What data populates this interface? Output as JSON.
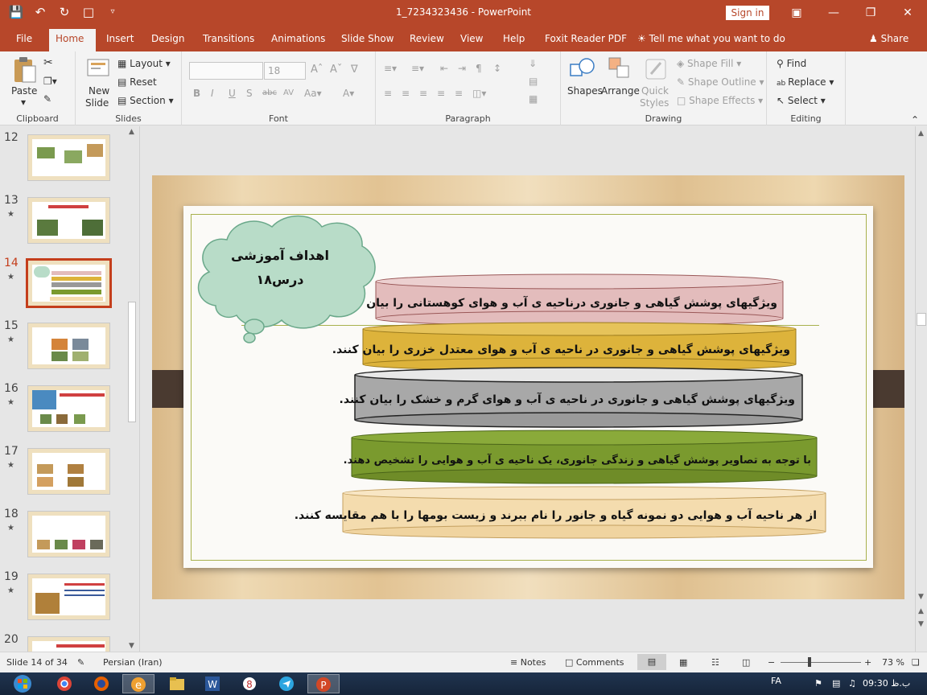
{
  "window": {
    "title": "1_7234323436  -  PowerPoint",
    "sign_in": "Sign in"
  },
  "tabs": [
    "File",
    "Home",
    "Insert",
    "Design",
    "Transitions",
    "Animations",
    "Slide Show",
    "Review",
    "View",
    "Help",
    "Foxit Reader PDF"
  ],
  "active_tab": "Home",
  "tell_me": "Tell me what you want to do",
  "share": "Share",
  "ribbon": {
    "clipboard": {
      "label": "Clipboard",
      "paste": "Paste"
    },
    "slides": {
      "label": "Slides",
      "new_slide_1": "New",
      "new_slide_2": "Slide",
      "layout": "Layout",
      "reset": "Reset",
      "section": "Section"
    },
    "font": {
      "label": "Font",
      "size": "18"
    },
    "paragraph": {
      "label": "Paragraph"
    },
    "drawing": {
      "label": "Drawing",
      "shapes": "Shapes",
      "arrange": "Arrange",
      "quick_styles_1": "Quick",
      "quick_styles_2": "Styles",
      "shape_fill": "Shape Fill",
      "shape_outline": "Shape Outline",
      "shape_effects": "Shape Effects"
    },
    "editing": {
      "label": "Editing",
      "find": "Find",
      "replace": "Replace",
      "select": "Select"
    }
  },
  "thumbnails": [
    {
      "num": "12",
      "star": false
    },
    {
      "num": "13",
      "star": true
    },
    {
      "num": "14",
      "star": true,
      "active": true
    },
    {
      "num": "15",
      "star": true
    },
    {
      "num": "16",
      "star": true
    },
    {
      "num": "17",
      "star": true
    },
    {
      "num": "18",
      "star": true
    },
    {
      "num": "19",
      "star": true
    },
    {
      "num": "20",
      "star": false
    }
  ],
  "slide": {
    "cloud_line1": "اهداف آموزشی",
    "cloud_line2": "درس۱۸",
    "objectives": [
      {
        "text": "ویژگیهای پوشش گیاهی و جانوری درناحیه ی آب و هوای کوهستانی را بیان کنند.",
        "color": "#e3bcbc"
      },
      {
        "text": "ویژگیهای پوشش گیاهی و جانوری در ناحیه ی آب و هوای معتدل خزری را بیان کنند.",
        "color": "#ddb33b"
      },
      {
        "text": "ویژگیهای پوشش گیاهی و جانوری در ناحیه ی آب  و هوای گرم و خشک را بیان کنند.",
        "color": "#a8a8a8"
      },
      {
        "text": "با توجه به تصاویر پوشش گیاهی و زندگی جانوری، یک ناحیه ی آب و هوایی را تشخیص دهند.",
        "color": "#7a9a2e"
      },
      {
        "text": "از هر ناحیه آب و هوایی دو نمونه گیاه و جانور را نام ببرند و زیست بومها را با هم مقایسه کنند.",
        "color": "#f4dcae"
      }
    ]
  },
  "status": {
    "slide_of": "Slide 14 of 34",
    "language": "Persian (Iran)",
    "notes": "Notes",
    "comments": "Comments",
    "zoom": "73 %"
  },
  "taskbar": {
    "lang": "FA",
    "time": "ب.ظ 09:30"
  }
}
